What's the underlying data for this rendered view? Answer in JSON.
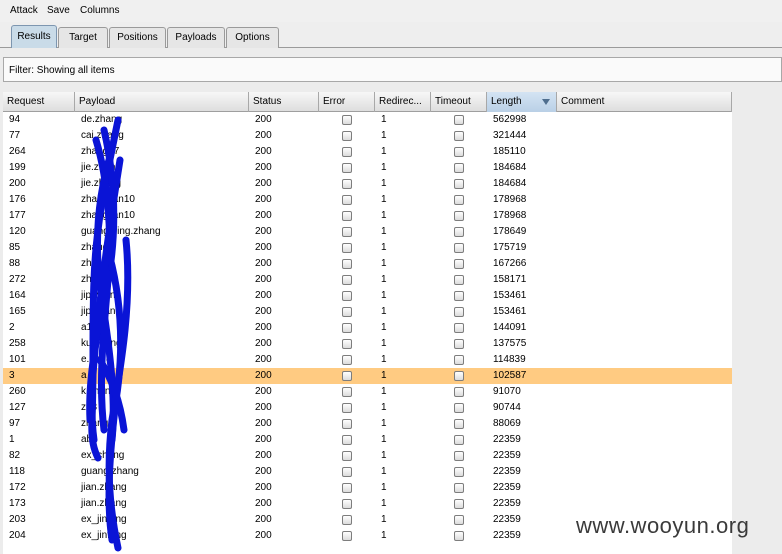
{
  "menu": {
    "items": [
      "Attack",
      "Save",
      "Columns"
    ]
  },
  "tabs": [
    "Results",
    "Target",
    "Positions",
    "Payloads",
    "Options"
  ],
  "active_tab": "Results",
  "filter": {
    "text": "Filter: Showing all items"
  },
  "columns": [
    "Request",
    "Payload",
    "Status",
    "Error",
    "Redirec...",
    "Timeout",
    "Length",
    "Comment"
  ],
  "sorted_column": "Length",
  "rows": [
    {
      "request": "94",
      "payload": "de.zhang",
      "status": "200",
      "redirects": "1",
      "length": "562998"
    },
    {
      "request": "77",
      "payload": "cai.zhang",
      "status": "200",
      "redirects": "1",
      "length": "321444"
    },
    {
      "request": "264",
      "payload": "zhang17",
      "status": "200",
      "redirects": "1",
      "length": "185110"
    },
    {
      "request": "199",
      "payload": "jie.zhang",
      "status": "200",
      "redirects": "1",
      "length": "184684"
    },
    {
      "request": "200",
      "payload": "jie.zhang",
      "status": "200",
      "redirects": "1",
      "length": "184684"
    },
    {
      "request": "176",
      "payload": "zhangjian10",
      "status": "200",
      "redirects": "1",
      "length": "178968"
    },
    {
      "request": "177",
      "payload": "zhangjian10",
      "status": "200",
      "redirects": "1",
      "length": "178968"
    },
    {
      "request": "120",
      "payload": "guangming.zhang",
      "status": "200",
      "redirects": "1",
      "length": "178649"
    },
    {
      "request": "85",
      "payload": "zhang",
      "status": "200",
      "redirects": "1",
      "length": "175719"
    },
    {
      "request": "88",
      "payload": "zh",
      "status": "200",
      "redirects": "1",
      "length": "167266"
    },
    {
      "request": "272",
      "payload": "zh",
      "status": "200",
      "redirects": "1",
      "length": "158171"
    },
    {
      "request": "164",
      "payload": "jip.zhang",
      "status": "200",
      "redirects": "1",
      "length": "153461"
    },
    {
      "request": "165",
      "payload": "jip.zhang",
      "status": "200",
      "redirects": "1",
      "length": "153461"
    },
    {
      "request": "2",
      "payload": "a1",
      "status": "200",
      "redirects": "1",
      "length": "144091"
    },
    {
      "request": "258",
      "payload": "ku.zhang",
      "status": "200",
      "redirects": "1",
      "length": "137575"
    },
    {
      "request": "101",
      "payload": "e.dong",
      "status": "200",
      "redirects": "1",
      "length": "114839"
    },
    {
      "request": "3",
      "payload": "a",
      "status": "200",
      "redirects": "1",
      "length": "102587"
    },
    {
      "request": "260",
      "payload": "k.zhang",
      "status": "200",
      "redirects": "1",
      "length": "91070"
    },
    {
      "request": "127",
      "payload": "zh3",
      "status": "200",
      "redirects": "1",
      "length": "90744"
    },
    {
      "request": "97",
      "payload": "zhang1",
      "status": "200",
      "redirects": "1",
      "length": "88069"
    },
    {
      "request": "1",
      "payload": "ab",
      "status": "200",
      "redirects": "1",
      "length": "22359"
    },
    {
      "request": "82",
      "payload": "ex_cheng",
      "status": "200",
      "redirects": "1",
      "length": "22359"
    },
    {
      "request": "118",
      "payload": "guang.zhang",
      "status": "200",
      "redirects": "1",
      "length": "22359"
    },
    {
      "request": "172",
      "payload": "jian.zhang",
      "status": "200",
      "redirects": "1",
      "length": "22359"
    },
    {
      "request": "173",
      "payload": "jian.zhang",
      "status": "200",
      "redirects": "1",
      "length": "22359"
    },
    {
      "request": "203",
      "payload": "ex_jinfeng",
      "status": "200",
      "redirects": "1",
      "length": "22359"
    },
    {
      "request": "204",
      "payload": "ex_jinfeng",
      "status": "200",
      "redirects": "1",
      "length": "22359"
    }
  ],
  "selected_row_index": 16,
  "colors": {
    "selected_row": "#ffcb82",
    "active_tab": "#c9dbe8",
    "scribble": "#0a14d6"
  },
  "watermark": "www.wooyun.org"
}
